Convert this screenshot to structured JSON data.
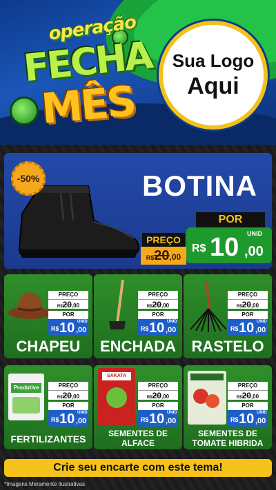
{
  "header": {
    "campaign_line1": "operação",
    "campaign_line2": "FECHA",
    "campaign_line3": "MÊS",
    "logo_line1": "Sua Logo",
    "logo_line2": "Aqui"
  },
  "hero": {
    "discount": "-50%",
    "title": "BOTINA",
    "preco_label": "PREÇO",
    "old_currency": "R$",
    "old_price": "20",
    "old_cents": ",00",
    "por_label": "POR",
    "unid_label": "UNID",
    "new_currency": "R$",
    "new_price": "10",
    "new_cents": ",00"
  },
  "products": [
    {
      "name": "CHAPEU",
      "preco_label": "PREÇO",
      "old_currency": "R$",
      "old_price": "20",
      "old_cents": ",00",
      "por_label": "POR",
      "unid_label": "UNID",
      "new_currency": "R$",
      "new_price": "10",
      "new_cents": ",00"
    },
    {
      "name": "ENCHADA",
      "preco_label": "PREÇO",
      "old_currency": "R$",
      "old_price": "20",
      "old_cents": ",00",
      "por_label": "POR",
      "unid_label": "UNID",
      "new_currency": "R$",
      "new_price": "10",
      "new_cents": ",00"
    },
    {
      "name": "RASTELO",
      "preco_label": "PREÇO",
      "old_currency": "R$",
      "old_price": "20",
      "old_cents": ",00",
      "por_label": "POR",
      "unid_label": "UNID",
      "new_currency": "R$",
      "new_price": "10",
      "new_cents": ",00"
    },
    {
      "name": "FERTILIZANTES",
      "preco_label": "PREÇO",
      "old_currency": "R$",
      "old_price": "20",
      "old_cents": ",00",
      "por_label": "POR",
      "unid_label": "UNID",
      "new_currency": "R$",
      "new_price": "10",
      "new_cents": ",00",
      "package_text": "Produtive"
    },
    {
      "name_line1": "SEMENTES DE",
      "name_line2": "ALFACE",
      "preco_label": "PREÇO",
      "old_currency": "R$",
      "old_price": "20",
      "old_cents": ",00",
      "por_label": "POR",
      "unid_label": "UNID",
      "new_currency": "R$",
      "new_price": "10",
      "new_cents": ",00",
      "package_text": "SAKATA"
    },
    {
      "name_line1": "SEMENTES DE",
      "name_line2": "TOMATE HIBRIDA",
      "preco_label": "PREÇO",
      "old_currency": "R$",
      "old_price": "20",
      "old_cents": ",00",
      "por_label": "POR",
      "unid_label": "UNID",
      "new_currency": "R$",
      "new_price": "10",
      "new_cents": ",00"
    }
  ],
  "footer": {
    "cta": "Crie seu encarte com este tema!",
    "disclaimer": "*Imagens Meramente Ilustrativas"
  },
  "colors": {
    "header_blue": "#1b56b8",
    "accent_green": "#25c24a",
    "accent_yellow": "#f4c21a",
    "price_green": "#1e9a2c",
    "price_blue": "#1e5ec8",
    "card_green": "#2f8f2a"
  }
}
